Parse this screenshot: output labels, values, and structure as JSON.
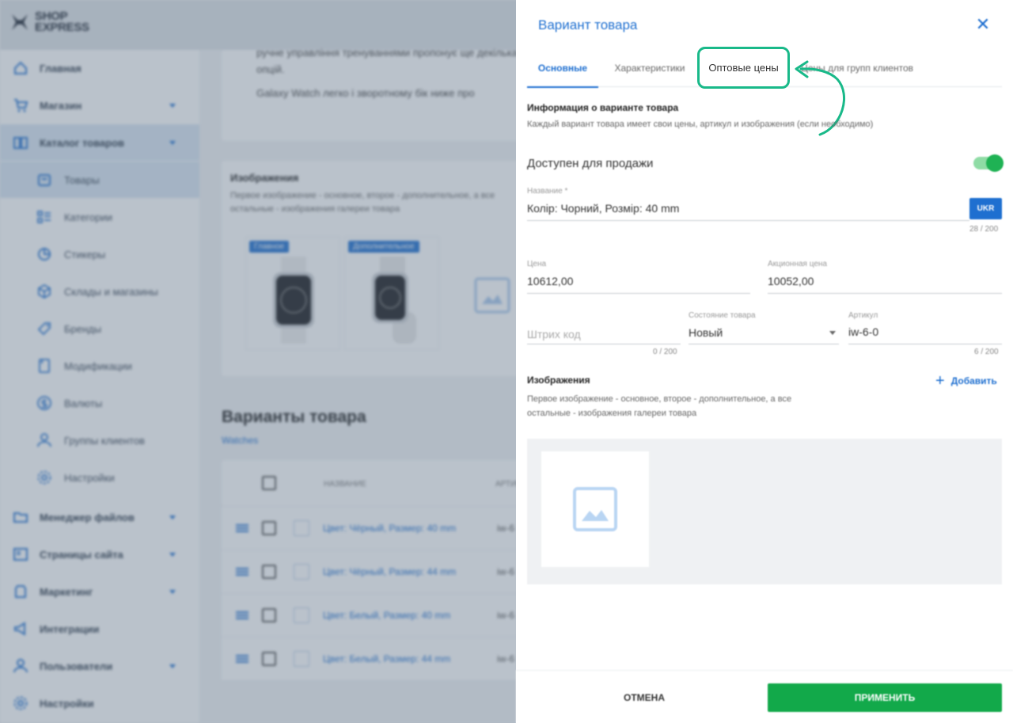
{
  "app": {
    "logo_line1": "SHOP",
    "logo_line2": "EXPRESS"
  },
  "sidebar": {
    "items": [
      {
        "label": "Главная",
        "icon": "home-icon"
      },
      {
        "label": "Магазин",
        "icon": "cart-icon"
      },
      {
        "label": "Каталог товаров",
        "icon": "catalog-icon"
      },
      {
        "label": "Менеджер файлов",
        "icon": "folder-icon"
      },
      {
        "label": "Страницы сайта",
        "icon": "pages-icon"
      },
      {
        "label": "Маркетинг",
        "icon": "marketing-icon"
      },
      {
        "label": "Интеграции",
        "icon": "megaphone-icon"
      },
      {
        "label": "Пользователи",
        "icon": "user-icon"
      },
      {
        "label": "Настройки",
        "icon": "gear-icon"
      }
    ],
    "catalog_sub": [
      {
        "label": "Товары",
        "icon": "box-icon"
      },
      {
        "label": "Категории",
        "icon": "list-icon"
      },
      {
        "label": "Стикеры",
        "icon": "sticker-icon"
      },
      {
        "label": "Склады и магазины",
        "icon": "warehouse-icon"
      },
      {
        "label": "Бренды",
        "icon": "tag-icon"
      },
      {
        "label": "Модификации",
        "icon": "bookmark-icon"
      },
      {
        "label": "Валюты",
        "icon": "currency-icon"
      },
      {
        "label": "Группы клиентов",
        "icon": "users-icon"
      },
      {
        "label": "Настройки",
        "icon": "gear-icon"
      }
    ]
  },
  "background": {
    "desc_line1": "ручне управління тренуваннями пропонує ще декілька",
    "desc_line2": "опцій.",
    "desc_line3": "Galaxy Watch легко і зворотному бік ниже про",
    "images_title": "Изображения",
    "images_sub_line1": "Первое изображение - основное, второе - дополнительное, а все",
    "images_sub_line2": "остальные - изображения галереи товара",
    "badge_main": "Главное",
    "badge_additional": "Дополнительное",
    "variants_title": "Варианты товара",
    "variants_link": "Watches",
    "col_name": "НАЗВАНИЕ",
    "col_article": "АРТИК",
    "rows": [
      {
        "name": "Цвет: Чёрный, Размер: 40 mm",
        "code": "iw-6"
      },
      {
        "name": "Цвет: Чёрный, Размер: 44 mm",
        "code": "iw-6"
      },
      {
        "name": "Цвет: Белый, Размер: 40 mm",
        "code": "iw-6"
      },
      {
        "name": "Цвет: Белый, Размер: 44 mm",
        "code": "iw-6"
      }
    ]
  },
  "drawer": {
    "title": "Вариант товара",
    "close_symbol": "✕",
    "tabs": {
      "main": "Основные",
      "characteristics": "Характеристики",
      "wholesale": "Оптовые цены",
      "groups": "Цены для групп клиентов"
    },
    "info_title": "Информация о варианте товара",
    "info_sub": "Каждый вариант товара имеет свои цены, артикул и изображения (если необходимо)",
    "available_label": "Доступен для продажи",
    "name_label": "Название *",
    "name_value": "Колір: Чорний, Розмір: 40 mm",
    "lang_button": "UKR",
    "name_counter": "28 / 200",
    "price_label": "Цена",
    "price_value": "10612,00",
    "promo_label": "Акционная цена",
    "promo_value": "10052,00",
    "barcode_placeholder": "Штрих код",
    "barcode_counter": "0 / 200",
    "condition_label": "Состояние товара",
    "condition_value": "Новый",
    "article_label": "Артикул",
    "article_value": "iw-6-0",
    "article_counter": "6 / 200",
    "images_title": "Изображения",
    "images_sub": "Первое изображение - основное, второе - дополнительное, а все остальные - изображения галереи товара",
    "add_label": "Добавить",
    "add_symbol": "+",
    "cancel_label": "ОТМЕНА",
    "apply_label": "ПРИМЕНИТЬ"
  },
  "colors": {
    "accent": "#1e6fd0",
    "highlight": "#19b989",
    "apply": "#12a94a"
  }
}
